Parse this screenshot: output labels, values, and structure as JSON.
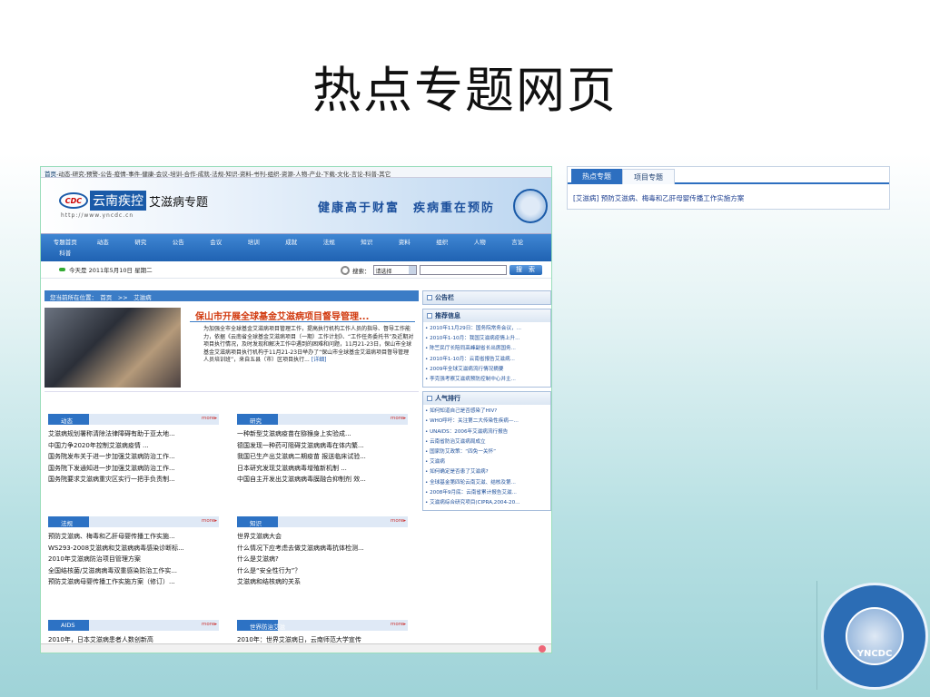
{
  "slide_title": "热点专题网页",
  "site": {
    "topnav": {
      "home": "首页",
      "links": "-动态-研究-预警-公告-疫情-事件-健康-会议-培训-合作-成就-法规-知识-资料-书刊-组织-资源-人物-产业-下载-文化-言论-科普-其它"
    },
    "logo": {
      "mark": "CDC",
      "name": "云南疾控",
      "subtitle": "艾滋病专题",
      "url": "http://www.yncdc.cn"
    },
    "slogan": "健康高于财富　疾病重在预防",
    "nav": [
      "专题首页",
      "动态",
      "研究",
      "公告",
      "会议",
      "培训",
      "成就",
      "法规",
      "知识",
      "资料",
      "组织",
      "人物",
      "言论",
      "科普"
    ],
    "date": "今天是 2011年5月10日 星期二",
    "search": {
      "label": "搜索：",
      "select": "请选择",
      "button": "搜　索"
    },
    "breadcrumb": "您当前所在位置：　首页　>>　艾滋病",
    "feature": {
      "title": "保山市开展全球基金艾滋病项目督导管理...",
      "text": "为加强全市全球基金艾滋病项目管理工作，提高执行机构工作人员的指导、督导工作能力，依据《云南省全球基金艾滋病项目（一期）工作计划》、“工作任务委托书”及近期对项目执行情况，及时发现和解决工作中遇到的困难和问题，11月21-23日，保山市全球基金艾滋病项目执行机构于11月21-23日举办了“保山市全球基金艾滋病项目督导管理人员培训班”，来自五县（市）区项目执行...",
      "more": "[详细]"
    },
    "boxes": [
      {
        "label": "动态",
        "more": "more▸",
        "items": [
          "艾滋病规划署称清除法律障碍有助于亚太地...",
          "中国力争2020年控制艾滋病疫情 ...",
          "国务院发布关于进一步加强艾滋病防治工作...",
          "国务院下发通知进一步加强艾滋病防治工作...",
          "国务院要求艾滋病重灾区实行一把手负责制..."
        ]
      },
      {
        "label": "研究",
        "more": "more▸",
        "items": [
          "一种新型艾滋病疫苗在猕猴身上实验成...",
          "德国发现一种药可阻碍艾滋病病毒在体内繁...",
          "我国已生产出艾滋病二期疫苗 报送临床试验...",
          "日本研究发现艾滋病病毒增殖新机制 ...",
          "中国自主开发出艾滋病病毒膜融合抑制剂 效..."
        ]
      },
      {
        "label": "法规",
        "more": "more▸",
        "items": [
          "预防艾滋病、梅毒和乙肝母婴传播工作实施...",
          "WS293-2008艾滋病和艾滋病病毒感染诊断标...",
          "2010年艾滋病防治项目管理方案",
          "全国结核菌/艾滋病病毒双重感染防治工作实...",
          "预防艾滋病母婴传播工作实施方案（修订）..."
        ]
      },
      {
        "label": "知识",
        "more": "more▸",
        "items": [
          "世界艾滋病大会",
          "什么情况下应考虑去做艾滋病病毒抗体检测...",
          "什么是艾滋病?",
          "什么是“安全性行为”？",
          "艾滋病和结核病的关系"
        ]
      },
      {
        "label": "AIDS",
        "more": "more▸",
        "items": [
          "2010年，日本艾滋病患者人数创新高"
        ]
      },
      {
        "label": "世界防治艾滋",
        "more": "more▸",
        "items": [
          "2010年：世界艾滋病日，云南师范大学宣传"
        ]
      }
    ],
    "panels": [
      {
        "title": "公告栏",
        "items": []
      },
      {
        "title": "推荐信息",
        "items": [
          "2010年11月29日：国务院常务会议，...",
          "2010年1-10月：我国艾滋病疫情上升...",
          "陈竺民厅长陪同高峰副省长出席国务...",
          "2010年1-10月：云南省报告艾滋病...",
          "2009年全球艾滋病流行情况摘要",
          "李克强考察艾滋病预防控制中心并主..."
        ]
      },
      {
        "title": "人气排行",
        "items": [
          "如何知道自己是否感染了HIV?",
          "WHO呼吁：关注第二大传染性疾病—...",
          "UNAIDS：2006年艾滋病流行报告",
          "云南省防治艾滋病局成立",
          "国家防艾政策：“四免一关怀”",
          "艾滋病",
          "如何确定是否患了艾滋病?",
          "全球基金第四轮云南艾滋、结核及第...",
          "2008年9月底：云南省累计报告艾滋...",
          "艾滋病综合研究项目(CIPRA,2004-20..."
        ]
      }
    ]
  },
  "topics_box": {
    "tabs": [
      "热点专题",
      "项目专题"
    ],
    "link": "[艾滋病] 预防艾滋病、梅毒和乙肝母婴传播工作实施方案"
  },
  "emblem": {
    "text": "YNCDC"
  }
}
